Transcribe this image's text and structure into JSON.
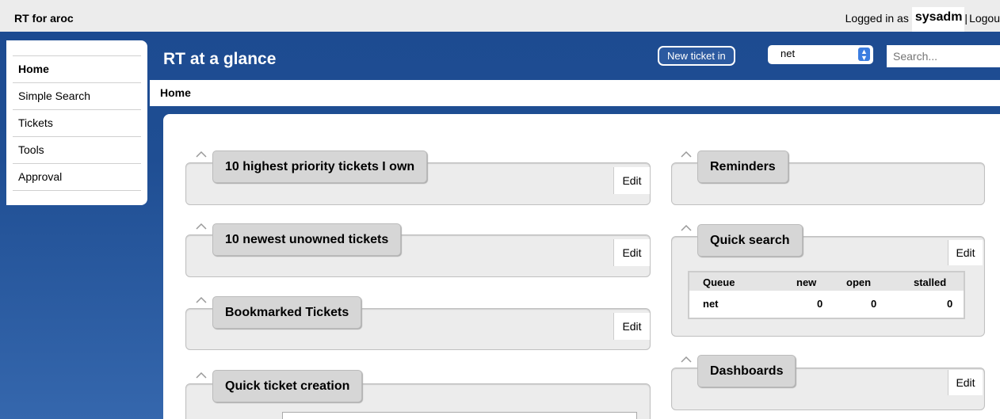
{
  "app": {
    "title": "RT for aroc"
  },
  "login": {
    "prefix": "Logged in as",
    "user": "sysadm",
    "separator": "|",
    "logout": "Logou"
  },
  "nav": {
    "items": [
      {
        "label": "Home",
        "active": true
      },
      {
        "label": "Simple Search",
        "active": false
      },
      {
        "label": "Tickets",
        "active": false
      },
      {
        "label": "Tools",
        "active": false
      },
      {
        "label": "Approval",
        "active": false
      }
    ]
  },
  "header": {
    "title": "RT at a glance",
    "new_ticket_label": "New ticket in",
    "queue_selected": "net",
    "search_placeholder": "Search..."
  },
  "breadcrumb": "Home",
  "widgets": {
    "priority": {
      "title": "10 highest priority tickets I own",
      "edit": "Edit"
    },
    "unowned": {
      "title": "10 newest unowned tickets",
      "edit": "Edit"
    },
    "bookmarked": {
      "title": "Bookmarked Tickets",
      "edit": "Edit"
    },
    "quick_create": {
      "title": "Quick ticket creation"
    },
    "reminders": {
      "title": "Reminders"
    },
    "quick_search": {
      "title": "Quick search",
      "edit": "Edit",
      "columns": [
        "Queue",
        "new",
        "open",
        "stalled"
      ],
      "rows": [
        {
          "queue": "net",
          "new": "0",
          "open": "0",
          "stalled": "0"
        }
      ]
    },
    "dashboards": {
      "title": "Dashboards",
      "edit": "Edit"
    }
  },
  "colors": {
    "brand_blue": "#1d4b91",
    "panel_gray": "#ececec",
    "title_gray": "#d6d6d6"
  }
}
